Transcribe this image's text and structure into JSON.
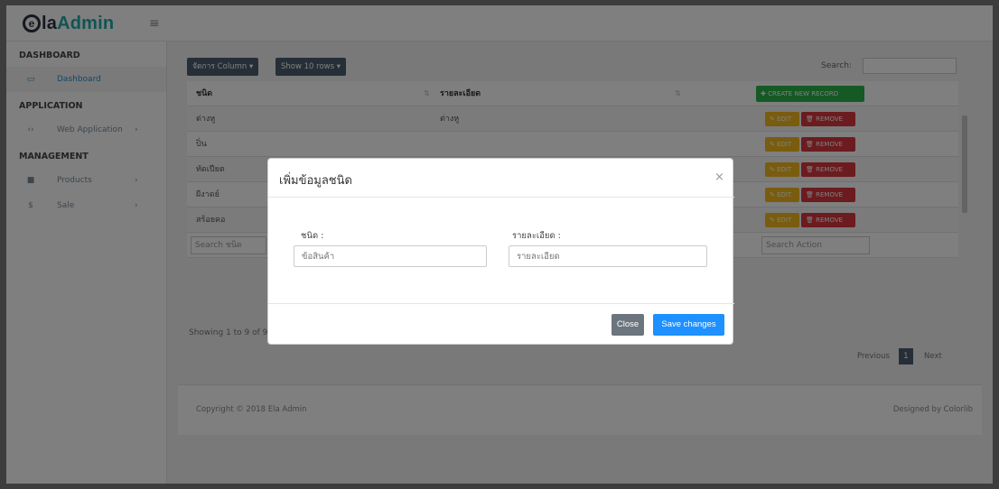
{
  "brand": {
    "logo_mark": "e",
    "logo_main": "la",
    "logo_accent": "Admin"
  },
  "sidebar": {
    "sections": [
      {
        "heading": "DASHBOARD",
        "items": [
          {
            "label": "Dashboard",
            "icon": "monitor-icon",
            "active": true
          }
        ]
      },
      {
        "heading": "APPLICATION",
        "items": [
          {
            "label": "Web Application",
            "icon": "code-icon",
            "chevron": true
          }
        ]
      },
      {
        "heading": "MANAGEMENT",
        "items": [
          {
            "label": "Products",
            "icon": "box-icon",
            "chevron": true
          },
          {
            "label": "Sale",
            "icon": "dollar-icon",
            "chevron": true
          }
        ]
      }
    ]
  },
  "toolbar": {
    "columns_label": "จัดการ Column ▾",
    "rows_label": "Show 10 rows ▾",
    "search_label": "Search:"
  },
  "table": {
    "headers": [
      "ชนิด",
      "รายละเอียด"
    ],
    "create_label": "✚ CREATE NEW RECORD",
    "edit_label": "✎ EDIT",
    "remove_label": "🗑 REMOVE",
    "rows": [
      {
        "col1": "ต่างหู",
        "col2": "ต่างหู"
      },
      {
        "col1": "ปิ่น",
        "col2": ""
      },
      {
        "col1": "ทัดเปียต",
        "col2": ""
      },
      {
        "col1": "ผีงาดย์",
        "col2": ""
      },
      {
        "col1": "สร้อยคอ",
        "col2": ""
      }
    ],
    "filter_col1": "Search ชนิด",
    "filter_action": "Search Action"
  },
  "pagination": {
    "showing": "Showing 1 to 9 of 9",
    "previous": "Previous",
    "page": "1",
    "next": "Next"
  },
  "footer": {
    "left": "Copyright © 2018 Ela Admin",
    "right": "Designed by Colorlib"
  },
  "modal": {
    "title": "เพิ่มข้อมูลชนิด",
    "close_symbol": "×",
    "field1_label": "ชนิด :",
    "field1_placeholder": "ข้อสินค้า",
    "field2_label": "รายละเอียด :",
    "field2_placeholder": "รายละเอียด",
    "close_btn": "Close",
    "save_btn": "Save changes"
  }
}
